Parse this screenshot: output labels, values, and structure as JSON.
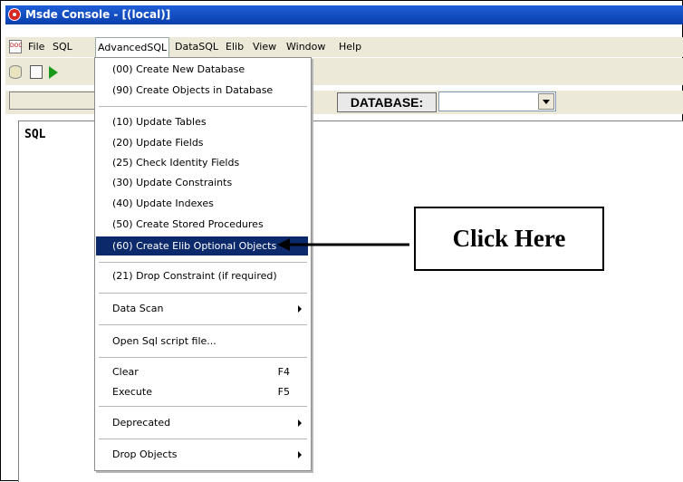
{
  "window": {
    "title": "Msde Console - [(local)]"
  },
  "menubar": {
    "doc_icon": "DOC",
    "items": [
      "File",
      "SQL",
      "AdvancedSQL",
      "DataSQL",
      "Elib",
      "View",
      "Window",
      "Help"
    ],
    "active": "AdvancedSQL"
  },
  "toolbar": {
    "icons": [
      "database-icon",
      "new-document-icon",
      "run-icon"
    ]
  },
  "database": {
    "label": "DATABASE:",
    "value": ""
  },
  "editor": {
    "label": "SQL"
  },
  "menu": {
    "items": [
      {
        "label": "(00) Create New Database"
      },
      {
        "label": "(90) Create Objects in Database"
      },
      {
        "label": "(10) Update Tables"
      },
      {
        "label": "(20) Update Fields"
      },
      {
        "label": "(25) Check Identity Fields"
      },
      {
        "label": "(30) Update Constraints"
      },
      {
        "label": "(40) Update Indexes"
      },
      {
        "label": "(50) Create Stored Procedures"
      },
      {
        "label": "(60) Create Elib Optional Objects",
        "highlighted": true
      },
      {
        "label": "(21) Drop Constraint (if required)"
      },
      {
        "label": "Data Scan",
        "submenu": true
      },
      {
        "label": "Open Sql script file..."
      },
      {
        "label": "Clear",
        "shortcut": "F4"
      },
      {
        "label": "Execute",
        "shortcut": "F5"
      },
      {
        "label": "Deprecated",
        "submenu": true
      },
      {
        "label": "Drop Objects",
        "submenu": true
      }
    ]
  },
  "annotation": {
    "text": "Click Here"
  },
  "colors": {
    "titlebar": "#0a3fae",
    "highlight": "#0c2a6b",
    "chrome": "#ece9d8"
  }
}
